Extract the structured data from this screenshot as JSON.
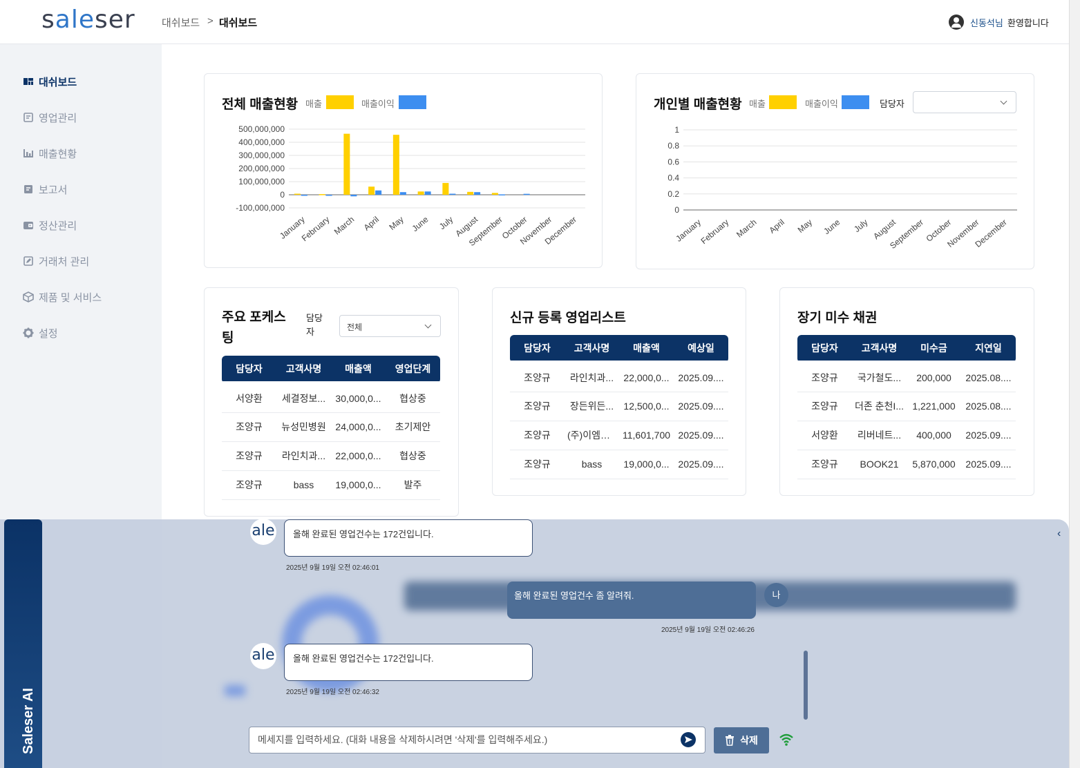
{
  "header": {
    "logo": "saleser",
    "breadcrumb_parent": "대쉬보드",
    "breadcrumb_sep": ">",
    "breadcrumb_current": "대쉬보드",
    "user_name": "신동석님",
    "welcome": "환영합니다"
  },
  "sidebar": {
    "items": [
      {
        "label": "대쉬보드",
        "icon": "dashboard-icon",
        "active": true
      },
      {
        "label": "영업관리",
        "icon": "note-icon",
        "active": false
      },
      {
        "label": "매출현황",
        "icon": "bar-chart-icon",
        "active": false
      },
      {
        "label": "보고서",
        "icon": "report-icon",
        "active": false
      },
      {
        "label": "정산관리",
        "icon": "wallet-icon",
        "active": false
      },
      {
        "label": "거래처 관리",
        "icon": "edit-icon",
        "active": false
      },
      {
        "label": "제품 및 서비스",
        "icon": "box-icon",
        "active": false
      },
      {
        "label": "설정",
        "icon": "gear-icon",
        "active": false
      }
    ]
  },
  "total_sales": {
    "title": "전체 매출현황",
    "legend_sales": "매출",
    "legend_profit": "매출이익"
  },
  "personal_sales": {
    "title": "개인별 매출현황",
    "legend_sales": "매출",
    "legend_profit": "매출이익",
    "owner_label": "담당자",
    "owner_value": ""
  },
  "chart_data": [
    {
      "type": "bar",
      "categories": [
        "January",
        "February",
        "March",
        "April",
        "May",
        "June",
        "July",
        "August",
        "September",
        "October",
        "November",
        "December"
      ],
      "series": [
        {
          "name": "매출",
          "color": "#ffd000",
          "values": [
            8000000,
            5000000,
            465000000,
            62000000,
            457000000,
            25000000,
            90000000,
            22000000,
            14000000,
            0,
            0,
            0
          ]
        },
        {
          "name": "매출이익",
          "color": "#3d8ef0",
          "values": [
            -3000000,
            -4000000,
            -12000000,
            33000000,
            20000000,
            25000000,
            8000000,
            20000000,
            3000000,
            7000000,
            0,
            0
          ]
        }
      ],
      "ylim": [
        -100000000,
        500000000
      ],
      "yticks": [
        "500,000,000",
        "400,000,000",
        "300,000,000",
        "200,000,000",
        "100,000,000",
        "0",
        "-100,000,000"
      ]
    },
    {
      "type": "bar",
      "categories": [
        "January",
        "February",
        "March",
        "April",
        "May",
        "June",
        "July",
        "August",
        "September",
        "October",
        "November",
        "December"
      ],
      "series": [
        {
          "name": "매출",
          "color": "#ffd000",
          "values": [
            0,
            0,
            0,
            0,
            0,
            0,
            0,
            0,
            0,
            0,
            0,
            0
          ]
        },
        {
          "name": "매출이익",
          "color": "#3d8ef0",
          "values": [
            0,
            0,
            0,
            0,
            0,
            0,
            0,
            0,
            0,
            0,
            0,
            0
          ]
        }
      ],
      "ylim": [
        0,
        1
      ],
      "yticks": [
        "1",
        "0.8",
        "0.6",
        "0.4",
        "0.2",
        "0"
      ]
    }
  ],
  "focus": {
    "title_line1": "주요 포케스",
    "title_line2": "팅",
    "owner_line1": "담당",
    "owner_line2": "자",
    "owner_value": "전체",
    "headers": [
      "담당자",
      "고객사명",
      "매출액",
      "영업단계"
    ],
    "rows": [
      [
        "서양환",
        "세결정보...",
        "30,000,0...",
        "협상중"
      ],
      [
        "조양규",
        "뉴성민병원",
        "24,000,0...",
        "초기제안"
      ],
      [
        "조양규",
        "라인치과...",
        "22,000,0...",
        "협상중"
      ],
      [
        "조양규",
        "bass",
        "19,000,0...",
        "발주"
      ]
    ]
  },
  "new_list": {
    "title": "신규 등록 영업리스트",
    "headers": [
      "담당자",
      "고객사명",
      "매출액",
      "예상일"
    ],
    "rows": [
      [
        "조양규",
        "라인치과...",
        "22,000,0...",
        "2025.09...."
      ],
      [
        "조양규",
        "장든위든...",
        "12,500,0...",
        "2025.09...."
      ],
      [
        "조양규",
        "(주)이엠에...",
        "11,601,700",
        "2025.09...."
      ],
      [
        "조양규",
        "bass",
        "19,000,0...",
        "2025.09...."
      ]
    ]
  },
  "overdue": {
    "title": "장기 미수 채권",
    "headers": [
      "담당자",
      "고객사명",
      "미수금",
      "지연일"
    ],
    "rows": [
      [
        "조양규",
        "국가철도...",
        "200,000",
        "2025.08...."
      ],
      [
        "조양규",
        "더존 춘천I...",
        "1,221,000",
        "2025.08...."
      ],
      [
        "서양환",
        "리버네트...",
        "400,000",
        "2025.09...."
      ],
      [
        "조양규",
        "BOOK21",
        "5,870,000",
        "2025.09...."
      ]
    ]
  },
  "ai": {
    "tab_label": "Saleser AI",
    "bot_avatar": "ale",
    "user_avatar": "나",
    "messages": [
      {
        "from": "bot",
        "text": "올해 완료된 영업건수는 172건입니다.",
        "time": "2025년 9월 19일 오전 02:46:01"
      },
      {
        "from": "user",
        "text": "올해 완료된 영업건수 좀 알려줘.",
        "time": "2025년 9월 19일 오전 02:46:26"
      },
      {
        "from": "bot",
        "text": "올해 완료된 영업건수는 172건입니다.",
        "time": "2025년 9월 19일 오전 02:46:32"
      }
    ],
    "input_placeholder": "메세지를 입력하세요. (대화 내용을 삭제하시려면 '삭제'를 입력해주세요.)",
    "delete_label": "삭제",
    "collapse_icon": "‹"
  }
}
